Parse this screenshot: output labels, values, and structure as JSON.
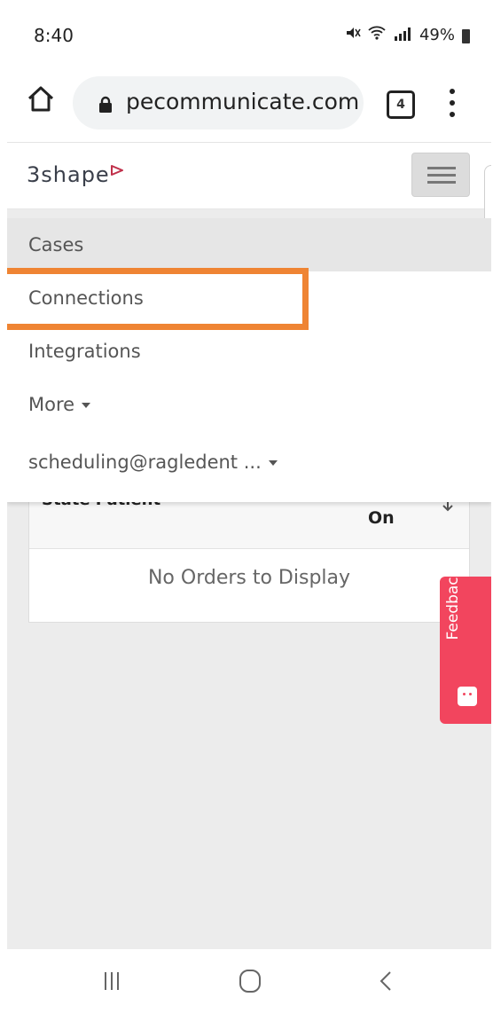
{
  "status": {
    "time": "8:40",
    "battery": "49%"
  },
  "browser": {
    "url": "pecommunicate.com",
    "tab_count": "4"
  },
  "app": {
    "logo_text": "3shape"
  },
  "menu": {
    "items": [
      {
        "label": "Cases",
        "active": true,
        "dropdown": false
      },
      {
        "label": "Connections",
        "active": false,
        "dropdown": false
      },
      {
        "label": "Integrations",
        "active": false,
        "dropdown": false
      },
      {
        "label": "More",
        "active": false,
        "dropdown": true
      },
      {
        "label": "scheduling@ragledent ...",
        "active": false,
        "dropdown": true
      }
    ]
  },
  "orders": {
    "header_state_patient": "State Patient",
    "header_on": "On",
    "empty_message": "No Orders to Display"
  },
  "feedback": {
    "label": "Feedback"
  },
  "colors": {
    "highlight": "#ef8433",
    "feedback_bg": "#f2455e",
    "logo_mark": "#c0304a"
  }
}
